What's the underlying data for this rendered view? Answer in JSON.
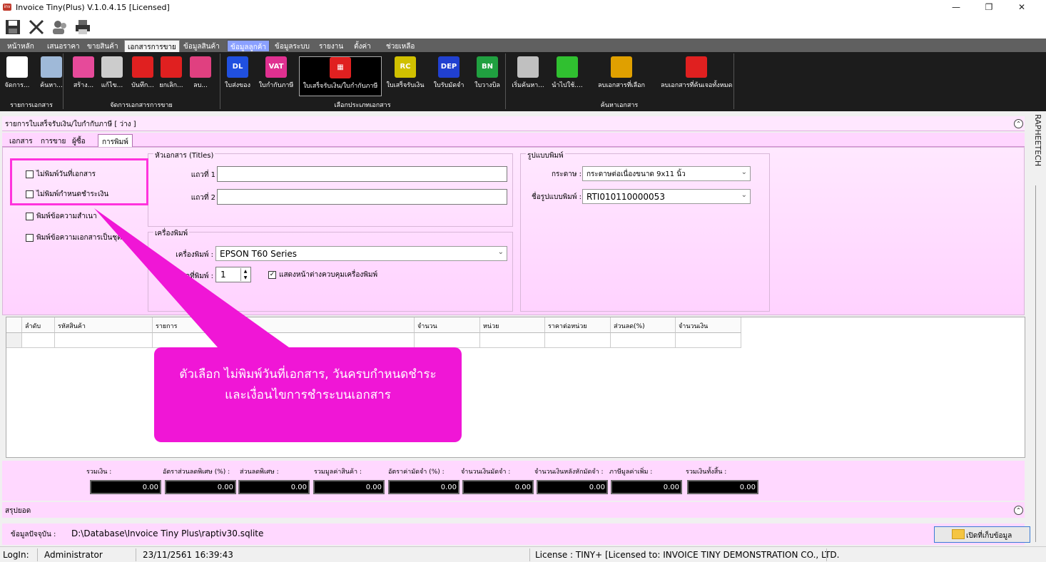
{
  "window": {
    "title": "Invoice Tiny(Plus)  V.1.0.4.15 [Licensed]",
    "minimize": "—",
    "restore": "❐",
    "close": "✕"
  },
  "quickbar": [
    "save-icon",
    "close-icon",
    "users-icon",
    "print-icon"
  ],
  "menu": {
    "tabs": [
      "หน้าหลัก",
      "เสนอราคา",
      "ขายสินค้า",
      "เอกสารการขาย",
      "ข้อมูลสินค้า",
      "ข้อมูลลูกค้า",
      "ข้อมูลระบบ",
      "รายงาน",
      "ตั้งค่า",
      "ช่วยเหลือ"
    ]
  },
  "ribbon": {
    "buttons": [
      {
        "label": "จัดการ...",
        "icon": "document-list-icon",
        "color": "#ffffff"
      },
      {
        "label": "ค้นหา...",
        "icon": "search-icon",
        "color": "#9fb9d8"
      },
      {
        "label": "สร้าง...",
        "icon": "create-icon",
        "color": "#e64a9a"
      },
      {
        "label": "แก้ไข...",
        "icon": "edit-icon",
        "color": "#cccccc"
      },
      {
        "label": "บันทึก...",
        "icon": "save-icon",
        "color": "#e02020"
      },
      {
        "label": "ยกเลิก...",
        "icon": "cancel-icon",
        "color": "#e02020"
      },
      {
        "label": "ลบ...",
        "icon": "delete-icon",
        "color": "#e04080"
      },
      {
        "label": "ใบส่งของ",
        "icon": "dl-icon",
        "color": "#2050e0",
        "badge": "DL"
      },
      {
        "label": "ใบกำกับภาษี",
        "icon": "vat-icon",
        "color": "#e03090",
        "badge": "VAT"
      },
      {
        "label": "ใบเสร็จรับเงิน/ใบกำกับภาษี",
        "icon": "receipt-tax-icon",
        "color": "#e02020",
        "badge": "▦"
      },
      {
        "label": "ใบเสร็จรับเงิน",
        "icon": "rc-icon",
        "color": "#d0c000",
        "badge": "RC"
      },
      {
        "label": "ใบรับมัดจำ",
        "icon": "dep-icon",
        "color": "#2040d0",
        "badge": "DEP"
      },
      {
        "label": "ใบวางบิล",
        "icon": "bn-icon",
        "color": "#20a040",
        "badge": "BN"
      },
      {
        "label": "เริ่มค้นหา...",
        "icon": "search-doc-icon",
        "color": "#c0c0c0"
      },
      {
        "label": "นำไปใช้....",
        "icon": "check-icon",
        "color": "#30c030"
      },
      {
        "label": "ลบเอกสารที่เลือก",
        "icon": "delete-selected-icon",
        "color": "#e0a000"
      },
      {
        "label": "ลบเอกสารที่ค้นเจอทั้งหมด",
        "icon": "delete-all-icon",
        "color": "#e02020"
      }
    ],
    "groups": [
      "รายการเอกสาร",
      "จัดการเอกสารการขาย",
      "เลือกประเภทเอกสาร",
      "ค้นหาเอกสาร"
    ]
  },
  "panel": {
    "header": "รายการใบเสร็จรับเงิน/ใบกำกับภาษี [ ว่าง ]",
    "tabs": [
      "เอกสาร",
      "การขาย",
      "ผู้ซื้อ",
      "การพิมพ์"
    ],
    "options": [
      {
        "label": "ไม่พิมพ์วันที่เอกสาร",
        "checked": false
      },
      {
        "label": "ไม่พิมพ์กำหนดชำระเงิน",
        "checked": false
      },
      {
        "label": "พิมพ์ข้อความสำเนา",
        "checked": false
      },
      {
        "label": "พิมพ์ข้อความเอกสารเป็นชุด",
        "checked": false
      }
    ],
    "titles": {
      "legend": "หัวเอกสาร (Titles)",
      "line1_label": "แถวที่ 1",
      "line1_value": "",
      "line2_label": "แถวที่ 2",
      "line2_value": ""
    },
    "printer": {
      "legend": "เครื่องพิมพ์",
      "printer_label": "เครื่องพิมพ์ :",
      "printer_value": "EPSON T60 Series",
      "copies_label": "ชุดที่พิมพ์ :",
      "copies_value": "1",
      "show_dialog_label": "แสดงหน้าต่างควบคุมเครื่องพิมพ์",
      "show_dialog_checked": true
    },
    "format": {
      "legend": "รูปแบบพิมพ์",
      "paper_label": "กระดาษ :",
      "paper_value": "กระดาษต่อเนื่องขนาด 9x11 นิ้ว",
      "form_label": "ชื่อรูปแบบพิมพ์ :",
      "form_value": "RTI010110000053"
    }
  },
  "callout": {
    "text": "ตัวเลือก ไม่พิมพ์วันที่เอกสาร, วันครบกำหนดชำระ และเงื่อนไขการชำระบนเอกสาร"
  },
  "grid": {
    "columns": [
      "ลำดับ",
      "รหัสสินค้า",
      "รายการ",
      "จำนวน",
      "หน่วย",
      "ราคาต่อหน่วย",
      "ส่วนลด(%)",
      "จำนวนเงิน"
    ]
  },
  "totals": [
    {
      "label": "รวมเงิน :",
      "value": "0.00"
    },
    {
      "label": "อัตราส่วนลดพิเศษ (%) :",
      "value": "0.00"
    },
    {
      "label": "ส่วนลดพิเศษ :",
      "value": "0.00"
    },
    {
      "label": "รวมมูลค่าสินค้า :",
      "value": "0.00"
    },
    {
      "label": "อัตราค่ามัดจำ (%) :",
      "value": "0.00"
    },
    {
      "label": "จำนวนเงินมัดจำ :",
      "value": "0.00"
    },
    {
      "label": "จำนวนเงินหลังหักมัดจำ :",
      "value": "0.00"
    },
    {
      "label": "ภาษีมูลค่าเพิ่ม :",
      "value": "0.00"
    },
    {
      "label": "รวมเงินทั้งสิ้น :",
      "value": "0.00"
    }
  ],
  "summary": {
    "label": "สรุปยอด"
  },
  "database": {
    "label": "ข้อมูลปัจจุบัน :",
    "path": "D:\\Database\\Invoice Tiny Plus\\raptiv30.sqlite",
    "open_button": "เปิดที่เก็บข้อมูล"
  },
  "status": {
    "login_label": "LogIn:",
    "user": "Administrator",
    "datetime": "23/11/2561 16:39:43",
    "license": "License : TINY+ [Licensed to: INVOICE TINY DEMONSTRATION CO., LTD."
  },
  "side_label": "RAPHEETECH",
  "colors": {
    "accent": "#f016d6",
    "panel": "#ffd8ff",
    "ribbon": "#1c1c1c"
  }
}
